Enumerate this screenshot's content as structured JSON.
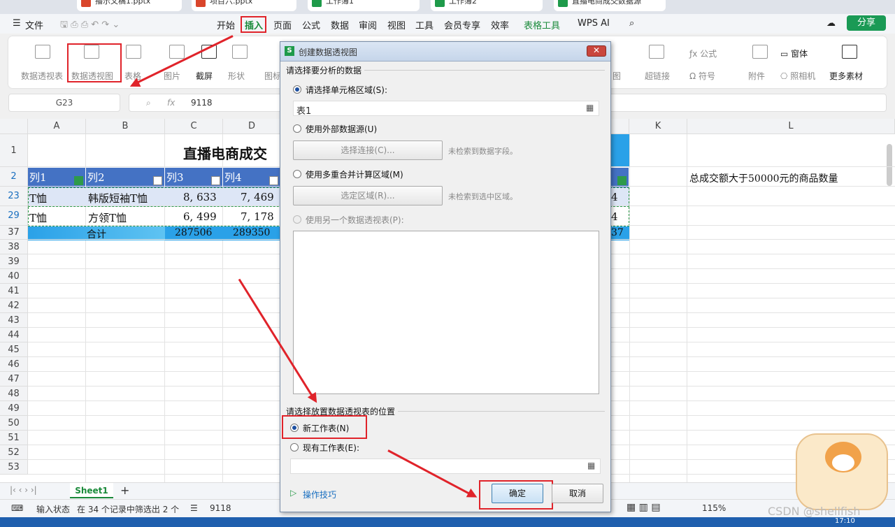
{
  "tabs": [
    "播示文稿1.pptx",
    "项目六.pptx",
    "工作簿1",
    "工作簿2",
    "直播电商成交数据源"
  ],
  "menu": {
    "file": "文件",
    "items": [
      "开始",
      "插入",
      "页面",
      "公式",
      "数据",
      "审阅",
      "视图",
      "工具",
      "会员专享",
      "效率",
      "表格工具",
      "WPS AI"
    ],
    "share": "分享"
  },
  "ribbon": {
    "pivot_table": "数据透视表",
    "pivot_chart": "数据透视图",
    "table": "表格",
    "picture": "图片",
    "screenshot": "截屏",
    "shape": "形状",
    "icon": "图标",
    "chart_frag": "图",
    "hyperlink": "超链接",
    "formula": "公式",
    "symbol": "符号",
    "attach": "附件",
    "camera": "照相机",
    "window": "窗体",
    "more": "更多素材"
  },
  "formula_bar": {
    "cell": "G23",
    "fx": "fx",
    "value": "9118"
  },
  "sheet": {
    "columns": [
      "A",
      "B",
      "C",
      "D",
      "K",
      "L"
    ],
    "title": "直播电商成交",
    "headers": [
      "列1",
      "列2",
      "列3",
      "列4"
    ],
    "rows": [
      {
        "num": "23",
        "a": "T恤",
        "b": "韩版短袖T恤",
        "c": "8, 633",
        "d": "7, 469",
        "j": "4"
      },
      {
        "num": "29",
        "a": "T恤",
        "b": "方领T恤",
        "c": "6, 499",
        "d": "7, 178",
        "j": "4"
      }
    ],
    "total": {
      "num": "37",
      "label": "合计",
      "c": "287506",
      "d": "289350",
      "j": "37"
    },
    "note": "总成交额大于50000元的商品数量",
    "row_numbers": [
      "1",
      "2",
      "23",
      "29",
      "37",
      "38",
      "39",
      "40",
      "41",
      "42",
      "43",
      "44",
      "45",
      "46",
      "47",
      "48",
      "49",
      "50",
      "51",
      "52",
      "53"
    ]
  },
  "sheet_tab": "Sheet1",
  "status": {
    "mode": "输入状态",
    "filter": "在 34 个记录中筛选出 2 个",
    "sum": "9118",
    "zoom": "115%"
  },
  "dialog": {
    "title": "创建数据透视图",
    "section1": "请选择要分析的数据",
    "opt_range": "请选择单元格区域(S):",
    "range_value": "表1",
    "opt_external": "使用外部数据源(U)",
    "btn_select_conn": "选择连接(C)...",
    "hint_conn": "未检索到数据字段。",
    "opt_multi": "使用多重合并计算区域(M)",
    "btn_select_area": "选定区域(R)...",
    "hint_area": "未检索到选中区域。",
    "opt_other": "使用另一个数据透视表(P):",
    "section2": "请选择放置数据透视表的位置",
    "opt_new": "新工作表(N)",
    "opt_existing": "现有工作表(E):",
    "tips": "操作技巧",
    "ok": "确定",
    "cancel": "取消"
  },
  "watermark": "CSDN @shellfish",
  "clock": "17:10"
}
